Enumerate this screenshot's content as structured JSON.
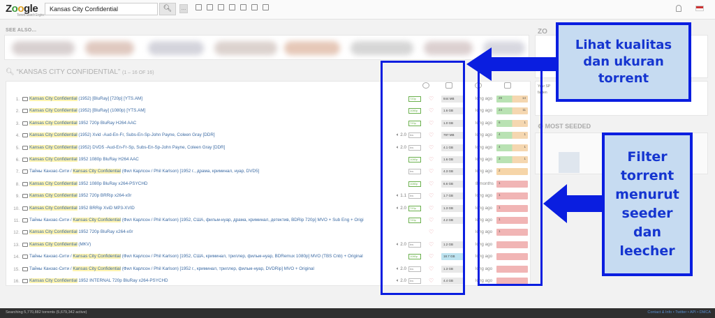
{
  "header": {
    "logo_parts": [
      "Z",
      "o",
      "o",
      "gle"
    ],
    "logo_sub": "Torrent Search Engine",
    "search_value": "Kansas City Confidential"
  },
  "see_also": {
    "label": "SEE ALSO..."
  },
  "results": {
    "title": "“KANSAS CITY CONFIDENTIAL”",
    "count": "(1 – 16 OF 16)",
    "rows": [
      {
        "num": "1.",
        "pre": "",
        "hl": "Kansas City Confidential",
        "post": " (1952) [BluRay] [720p] [YTS.AM]",
        "dur": "",
        "qual": "720p",
        "ok": true,
        "size": "844 MB",
        "size_hi": false,
        "age": "long ago",
        "seed": "g",
        "s": "29",
        "l": "14"
      },
      {
        "num": "2.",
        "pre": "",
        "hl": "Kansas City Confidential",
        "post": " (1952) [BluRay] (1080p) [YTS.AM]",
        "dur": "",
        "qual": "1080p",
        "ok": true,
        "size": "1.6 GB",
        "size_hi": false,
        "age": "long ago",
        "seed": "g",
        "s": "24",
        "l": "11"
      },
      {
        "num": "3.",
        "pre": "",
        "hl": "Kansas City Confidential",
        "post": " 1952 720p BluRay H264 AAC",
        "dur": "",
        "qual": "720p",
        "ok": true,
        "size": "1.0 GB",
        "size_hi": false,
        "age": "long ago",
        "seed": "g",
        "s": "6",
        "l": "1"
      },
      {
        "num": "4.",
        "pre": "",
        "hl": "Kansas City Confidential",
        "post": " (1952) Xvid -Aud-En-Fr, Subs-En-Sp-John Payne, Coleen Gray [DDR]",
        "dur": "2.0",
        "qual": "bw",
        "ok": false,
        "size": "797 MB",
        "size_hi": false,
        "age": "long ago",
        "seed": "g",
        "s": "4",
        "l": "1"
      },
      {
        "num": "5.",
        "pre": "",
        "hl": "Kansas City Confidential",
        "post": " (1952) DVD5 -Aud-En-Fr-Sp, Subs-En-Sp-John Payne, Coleen Gray [DDR]",
        "dur": "2.0",
        "qual": "bw",
        "ok": false,
        "size": "4.1 GB",
        "size_hi": false,
        "age": "long ago",
        "seed": "g",
        "s": "4",
        "l": "1"
      },
      {
        "num": "6.",
        "pre": "",
        "hl": "Kansas City Confidential",
        "post": " 1952 1080p BluRay H264 AAC",
        "dur": "",
        "qual": "1080p",
        "ok": true,
        "size": "1.6 GB",
        "size_hi": false,
        "age": "long ago",
        "seed": "g",
        "s": "3",
        "l": "1"
      },
      {
        "num": "7.",
        "pre": "Тайны Канзас-Сити / ",
        "hl": "Kansas City Confidential",
        "post": " (Фил Карлсон / Phil Karlson) [1952 г., драма, криминал, нуар, DVD5]",
        "dur": "",
        "qual": "bw",
        "ok": false,
        "size": "4.3 GB",
        "size_hi": false,
        "age": "long ago",
        "seed": "o",
        "s": "2",
        "l": ""
      },
      {
        "num": "8.",
        "pre": "",
        "hl": "Kansas City Confidential",
        "post": " 1952 1080p BluRay x264-PSYCHD",
        "dur": "",
        "qual": "1080p",
        "ok": true,
        "size": "6.6 GB",
        "size_hi": false,
        "age": "8 months",
        "seed": "r",
        "s": "1",
        "l": ""
      },
      {
        "num": "9.",
        "pre": "",
        "hl": "Kansas City Confidential",
        "post": " 1952 720p BRRip x264-x0r",
        "dur": "1.1",
        "qual": "bw",
        "ok": false,
        "size": "1.7 GB",
        "size_hi": false,
        "age": "long ago",
        "seed": "r",
        "s": "1",
        "l": ""
      },
      {
        "num": "10.",
        "pre": "",
        "hl": "Kansas City Confidential",
        "post": " 1952 BRRip XviD MP3-XVID",
        "dur": "2.0",
        "qual": "720p",
        "ok": true,
        "size": "1.3 GB",
        "size_hi": false,
        "age": "long ago",
        "seed": "r",
        "s": "1",
        "l": ""
      },
      {
        "num": "11.",
        "pre": "Тайны Канзас-Сити / ",
        "hl": "Kansas City Confidential",
        "post": " (Фил Карлсон / Phil Karlson) [1952, США, фильм-нуар, драма, криминал, детектив, BDRip 720p] MVO + Sub Eng + Origi",
        "dur": "",
        "qual": "720p",
        "ok": true,
        "size": "4.2 GB",
        "size_hi": false,
        "age": "long ago",
        "seed": "r",
        "s": "1",
        "l": ""
      },
      {
        "num": "12.",
        "pre": "",
        "hl": "Kansas City Confidential",
        "post": " 1952 720p BluRay x264-x0r",
        "dur": "",
        "qual": "",
        "ok": false,
        "size": "",
        "size_hi": false,
        "age": "long ago",
        "seed": "r",
        "s": "1",
        "l": ""
      },
      {
        "num": "13.",
        "pre": "",
        "hl": "Kansas City Confidential",
        "post": " (MKV)",
        "dur": "2.0",
        "qual": "bw",
        "ok": false,
        "size": "1.2 GB",
        "size_hi": false,
        "age": "long ago",
        "seed": "r",
        "s": "",
        "l": ""
      },
      {
        "num": "14.",
        "pre": "Тайны Канзас-Сити / ",
        "hl": "Kansas City Confidential",
        "post": " (Фил Карлсон / Phil Karlson) [1952, США, криминал, триллер, фильм-нуар, BDRemux 1080p] MVO (TBS Cnb) + Original",
        "dur": "",
        "qual": "1080p",
        "ok": true,
        "size": "18.7 GB",
        "size_hi": true,
        "age": "long ago",
        "seed": "r",
        "s": "",
        "l": ""
      },
      {
        "num": "15.",
        "pre": "Тайны Канзас-Сити / ",
        "hl": "Kansas City Confidential",
        "post": " (Фил Карлсон / Phil Karlson) [1952 г., криминал, триллер, фильм-нуар, DVDRip] MVO + Original",
        "dur": "2.0",
        "qual": "bw",
        "ok": false,
        "size": "1.3 GB",
        "size_hi": false,
        "age": "long ago",
        "seed": "r",
        "s": "",
        "l": ""
      },
      {
        "num": "16.",
        "pre": "",
        "hl": "Kansas City Confidential",
        "post": " 1952 INTERNAL 720p BluRay x264-PSYCHD",
        "dur": "2.0",
        "qual": "bw",
        "ok": false,
        "size": "4.4 GB",
        "size_hi": false,
        "age": "long ago",
        "seed": "r",
        "s": "",
        "l": ""
      }
    ]
  },
  "sidebar": {
    "zo_label": "ZO",
    "lines": [
      "Your SP",
      "",
      "",
      "fasten"
    ],
    "most_seeded": "MOST SEEDED"
  },
  "annotations": {
    "quality_note": [
      "Lihat kualitas",
      "dan ukuran",
      "torrent"
    ],
    "filter_note": [
      "Filter",
      "torrent",
      "menurut",
      "seeder",
      "dan",
      "leecher"
    ],
    "color": "#0a1ee0",
    "fill": "#c6dbf1"
  },
  "footer": {
    "stats": "Searching 5,770,882 torrents (5,679,342 active)",
    "links": "Contact & Info • Twitter • API • DMCA"
  }
}
